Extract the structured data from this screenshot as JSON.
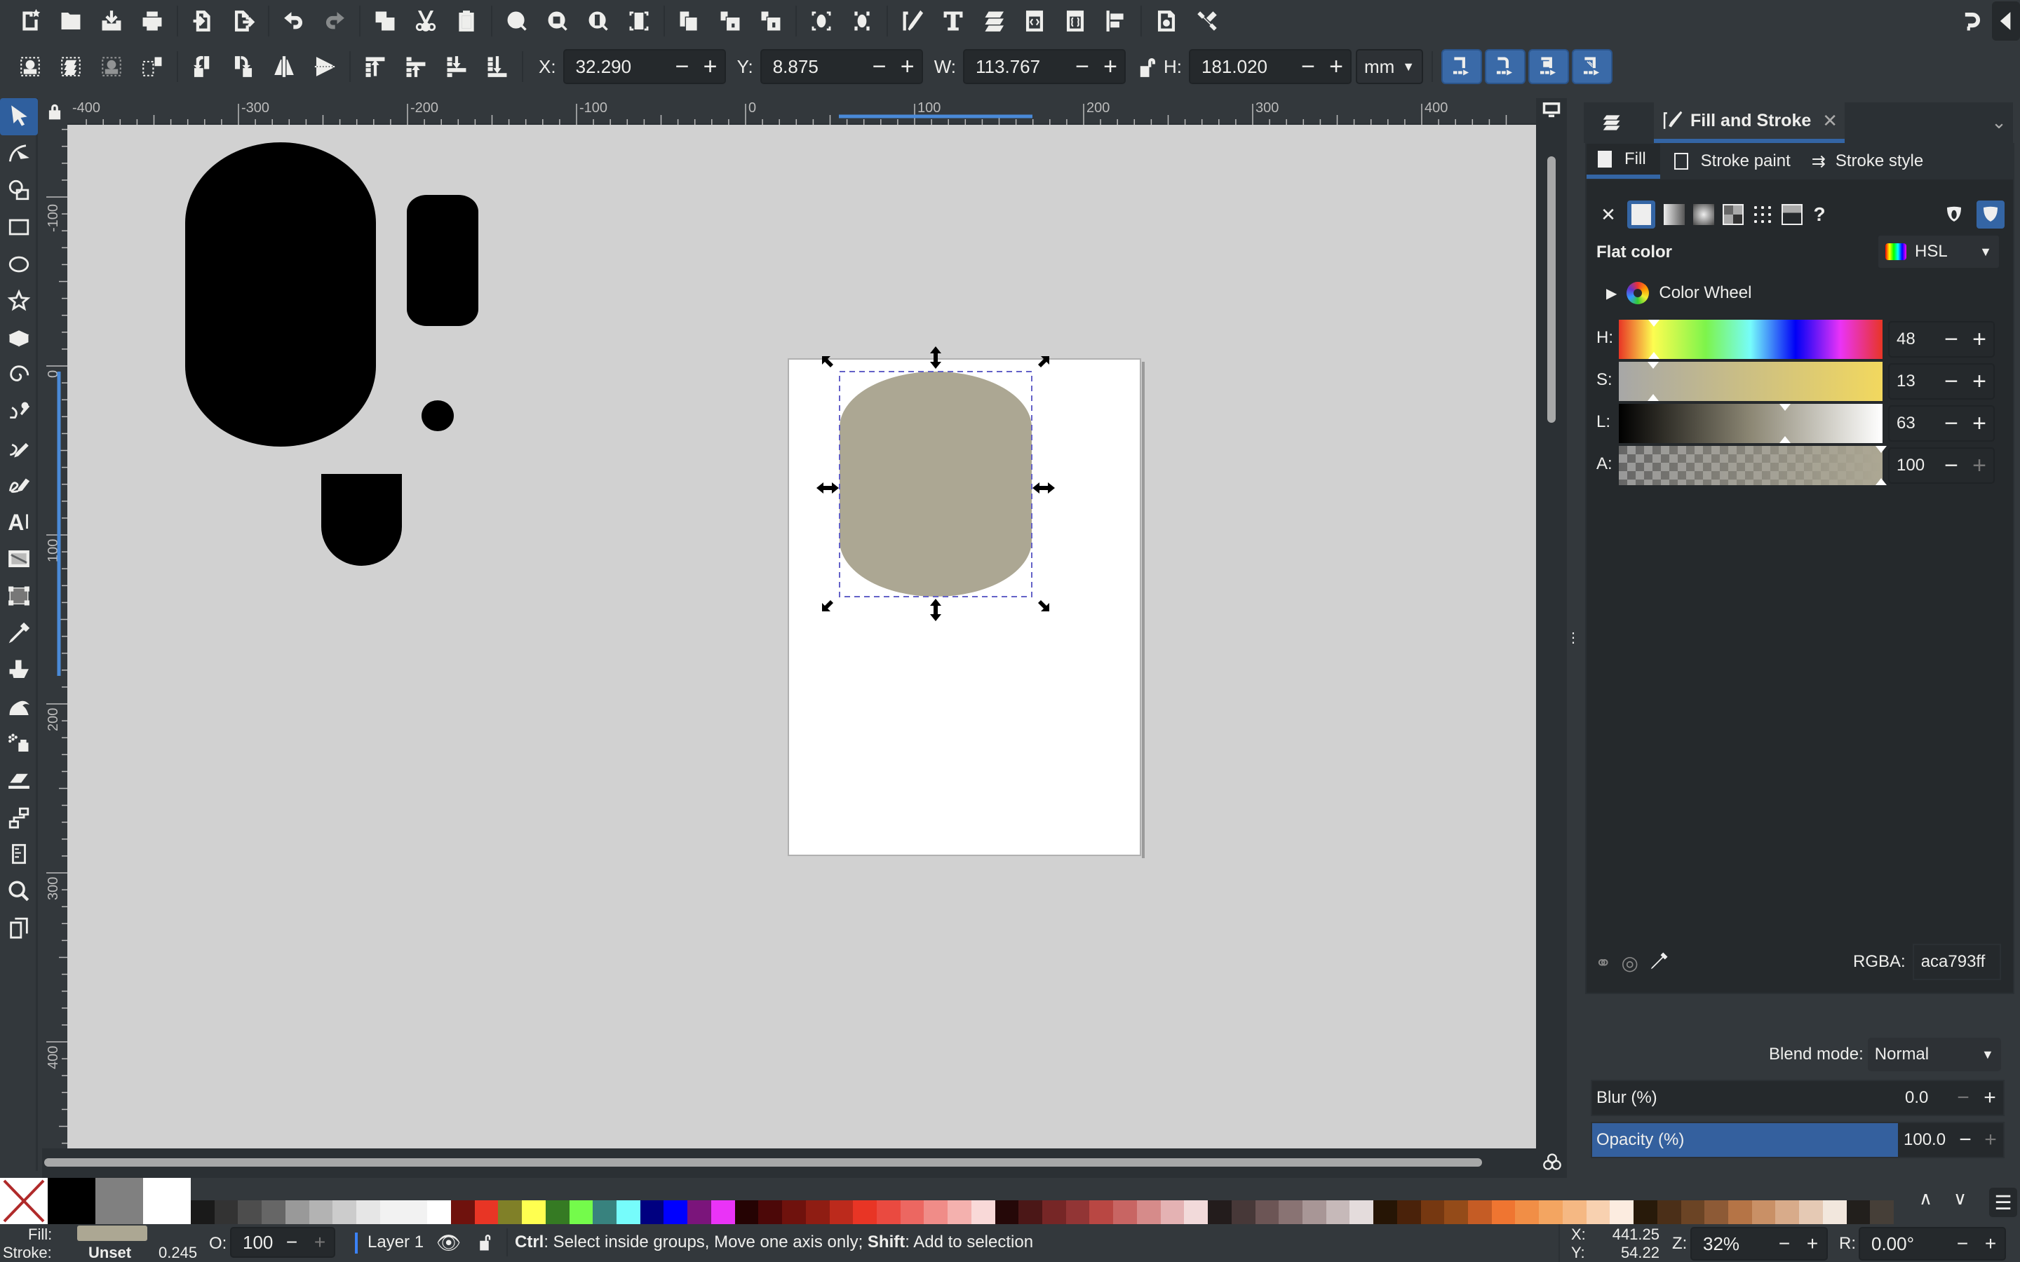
{
  "commands_bar": {
    "icons": [
      "new-document",
      "open-file",
      "save",
      "print",
      "import",
      "export",
      "undo",
      "redo",
      "copy",
      "cut",
      "paste",
      "zoom-selection",
      "zoom-drawing",
      "zoom-page",
      "zoom-page-width",
      "duplicate",
      "clone",
      "unlink-clone",
      "group",
      "ungroup",
      "fill-stroke",
      "text-font",
      "layers",
      "xml-editor",
      "selectors",
      "align-distribute",
      "document-properties",
      "preferences"
    ],
    "right_icons": [
      "snap-toggle",
      "collapse-sidebar"
    ]
  },
  "tool_controls": {
    "x_label": "X:",
    "x_value": "32.290",
    "y_label": "Y:",
    "y_value": "8.875",
    "w_label": "W:",
    "w_value": "113.767",
    "h_label": "H:",
    "h_value": "181.020",
    "unit": "mm",
    "minus": "−",
    "plus": "+"
  },
  "rulers": {
    "horizontal": [
      "-400",
      "-300",
      "-200",
      "-100",
      "0",
      "100",
      "200",
      "300",
      "400"
    ],
    "vertical": [
      "-100",
      "0",
      "100",
      "200",
      "300",
      "400"
    ]
  },
  "toolbox": [
    "selector",
    "node",
    "shape-builder",
    "rectangle",
    "ellipse",
    "star",
    "3d-box",
    "spiral",
    "bezier",
    "pencil",
    "calligraphy",
    "text",
    "gradient",
    "mesh",
    "dropper",
    "paint-bucket",
    "tweak",
    "spray",
    "eraser",
    "connector",
    "measure",
    "zoom",
    "pages"
  ],
  "canvas": {
    "selected_fill": "#aca793",
    "page_color": "#ffffff",
    "desk_color": "#d1d1d1"
  },
  "panel": {
    "layers_tab_icon": "layers-icon",
    "active_tab": "Fill and Stroke",
    "subtabs": [
      "Fill",
      "Stroke paint",
      "Stroke style"
    ],
    "paint_type": "Flat color",
    "color_mode": "HSL",
    "color_wheel_label": "Color Wheel",
    "sliders": [
      {
        "label": "H:",
        "value": "48",
        "fraction": 0.133
      },
      {
        "label": "S:",
        "value": "13",
        "fraction": 0.13
      },
      {
        "label": "L:",
        "value": "63",
        "fraction": 0.63
      },
      {
        "label": "A:",
        "value": "100",
        "fraction": 1.0
      }
    ],
    "rgba_label": "RGBA:",
    "rgba_value": "aca793ff",
    "blend_label": "Blend mode:",
    "blend_value": "Normal",
    "blur_label": "Blur (%)",
    "blur_value": "0.0",
    "opacity_label": "Opacity (%)",
    "opacity_value": "100.0",
    "unknown": "?"
  },
  "palette": {
    "swatches_main": [
      "#000000",
      "#808080",
      "#ffffff"
    ],
    "swatches": [
      "#1a1a1a",
      "#333333",
      "#4d4d4d",
      "#666666",
      "#999999",
      "#b3b3b3",
      "#cccccc",
      "#e6e6e6",
      "#f2f2f2",
      "#f2f2f2",
      "#ffffff",
      "#6f120d",
      "#e83525",
      "#808028",
      "#ffff50",
      "#357a23",
      "#74fb4b",
      "#38827e",
      "#76fcfb",
      "#000080",
      "#0000ff",
      "#7b157b",
      "#ea33f7",
      "#250303",
      "#4c0808",
      "#6f120d",
      "#8f1d13",
      "#bc2a1c",
      "#e83525",
      "#ea4a40",
      "#ec6761",
      "#f08c88",
      "#f4b1ae",
      "#f9d9d8",
      "#250808",
      "#4b1717",
      "#762626",
      "#923535",
      "#b94743",
      "#c86563",
      "#d68b8a",
      "#e4b2b3",
      "#f2dada",
      "#231c1c",
      "#473838",
      "#6c5555",
      "#897373",
      "#a89696",
      "#c6b9b9",
      "#e4dcdc",
      "#261505",
      "#4a220a",
      "#763811",
      "#944b19",
      "#c55c25",
      "#ef7531",
      "#f18e46",
      "#f3a561",
      "#f5b883",
      "#f8d1b0",
      "#fcece0",
      "#281a0a",
      "#4b2f18",
      "#6b4425",
      "#8d5a36",
      "#b57446",
      "#c99066",
      "#d8ab8a",
      "#e5c9b4",
      "#f2e7dd",
      "#221f1c",
      "#463f38"
    ]
  },
  "status": {
    "fill_label": "Fill:",
    "stroke_label": "Stroke:",
    "stroke_value": "Unset",
    "stroke_width": "0.245",
    "opacity_label": "O:",
    "opacity_value": "100",
    "layer": "Layer 1",
    "message_ctrl": "Ctrl",
    "message_ctrl_text": ": Select inside groups, Move one axis only; ",
    "message_shift": "Shift",
    "message_shift_text": ": Add to selection",
    "cursor_x_label": "X:",
    "cursor_x": "441.25",
    "cursor_y_label": "Y:",
    "cursor_y": "54.22",
    "zoom_label": "Z:",
    "zoom_value": "32%",
    "rotation_label": "R:",
    "rotation_value": "0.00°"
  }
}
